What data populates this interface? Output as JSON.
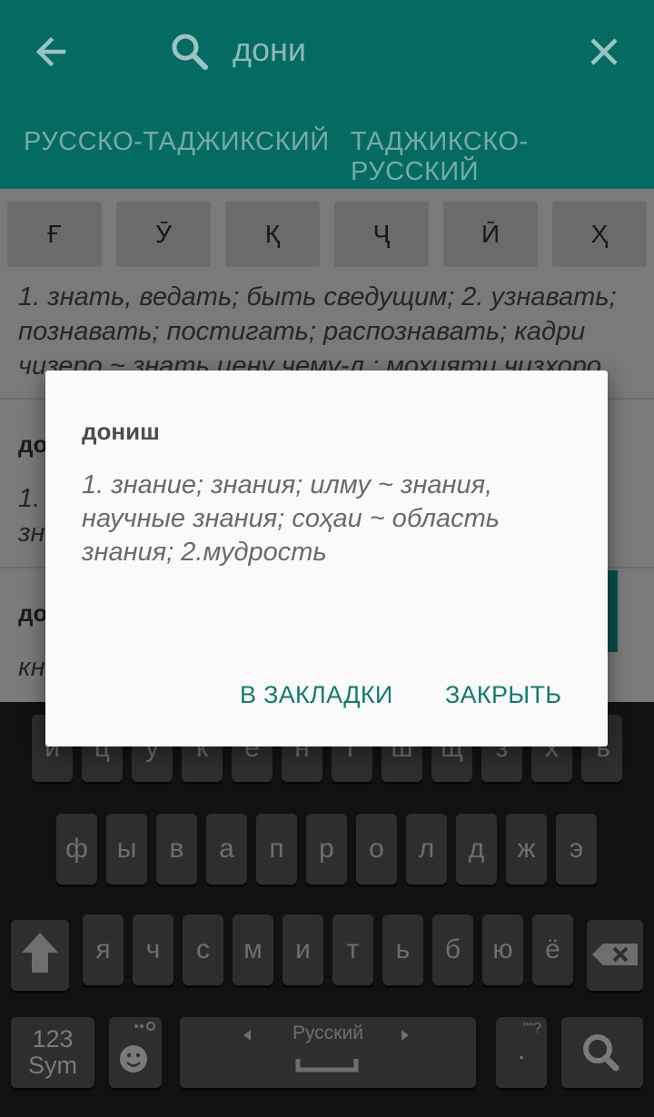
{
  "appbar": {
    "search_query": "дони",
    "tabs": [
      "РУССКО-ТАДЖИКСКИЙ",
      "ТАДЖИКСКО-РУССКИЙ"
    ],
    "color": "#046b63"
  },
  "letter_keys": [
    "Ғ",
    "Ӯ",
    "Қ",
    "Ҷ",
    "Ӣ",
    "Ҳ"
  ],
  "entries": [
    {
      "title": "",
      "lines": [
        "1. знать, ведать; быть сведущим; 2. узнавать;",
        "познавать; постигать; распознавать; кадри",
        "чизеро ~ знать цену чему-л.; мохияти чизхоро"
      ]
    },
    {
      "title": "до",
      "lines": [
        "1.",
        "зн"
      ]
    },
    {
      "title": "до",
      "lines": [
        "кн"
      ]
    }
  ],
  "dialog": {
    "title": "дониш",
    "body": "1. знание; знания; илму ~ знания, научные знания; соҳаи ~ область знания; 2.мудрость",
    "bookmark_button": "В ЗАКЛАДКИ",
    "close_button": "ЗАКРЫТЬ",
    "accent": "#117b71"
  },
  "keyboard": {
    "row1": [
      "й",
      "ц",
      "у",
      "к",
      "е",
      "н",
      "г",
      "ш",
      "щ",
      "з",
      "х",
      "ъ"
    ],
    "row2": [
      "ф",
      "ы",
      "в",
      "а",
      "п",
      "р",
      "о",
      "л",
      "д",
      "ж",
      "э"
    ],
    "row3": [
      "я",
      "ч",
      "с",
      "м",
      "и",
      "т",
      "ь",
      "б",
      "ю",
      "ё"
    ],
    "sym_top": "123",
    "sym_bottom": "Sym",
    "language": "Русский",
    "period": ".",
    "shift_icon": "shift-icon",
    "backspace_icon": "backspace-icon",
    "emoji_icon": "emoji-icon",
    "search_icon": "search-icon"
  }
}
